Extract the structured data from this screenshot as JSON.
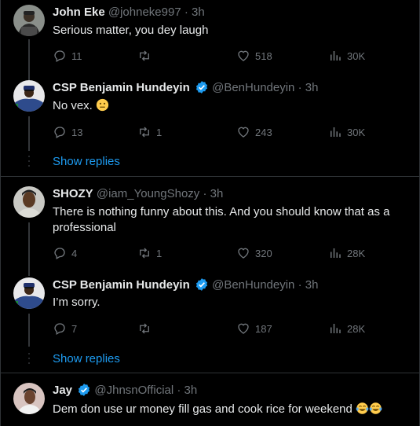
{
  "colors": {
    "accent": "#1d9bf0",
    "muted": "#71767b",
    "text": "#e7e9ea",
    "background": "#000000",
    "verified": "#1d9bf0"
  },
  "tweets": [
    {
      "name": "John Eke",
      "handle": "@johneke997",
      "dot": "·",
      "time": "3h",
      "verified": false,
      "text": "Serious matter, you dey laugh",
      "replies": "11",
      "retweets": "",
      "likes": "518",
      "views": "30K"
    },
    {
      "name": "CSP Benjamin Hundeyin",
      "handle": "@BenHundeyin",
      "dot": "·",
      "time": "3h",
      "verified": true,
      "text": "No vex.",
      "emoji": "neutral-face",
      "replies": "13",
      "retweets": "1",
      "likes": "243",
      "views": "30K"
    },
    {
      "name": "SHOZY",
      "handle": "@iam_YoungShozy",
      "dot": "·",
      "time": "3h",
      "verified": false,
      "text": "There is nothing funny about this. And you should know that as a professional",
      "replies": "4",
      "retweets": "1",
      "likes": "320",
      "views": "28K"
    },
    {
      "name": "CSP Benjamin Hundeyin",
      "handle": "@BenHundeyin",
      "dot": "·",
      "time": "3h",
      "verified": true,
      "text": "I’m sorry.",
      "replies": "7",
      "retweets": "",
      "likes": "187",
      "views": "28K"
    },
    {
      "name": "Jay",
      "handle": "@JhnsnOfficial",
      "dot": "·",
      "time": "3h",
      "verified": true,
      "text": "Dem don use ur money fill gas and cook rice for weekend",
      "emoji": "tears-of-joy x2"
    }
  ],
  "show_replies": [
    "Show replies",
    "Show replies"
  ]
}
